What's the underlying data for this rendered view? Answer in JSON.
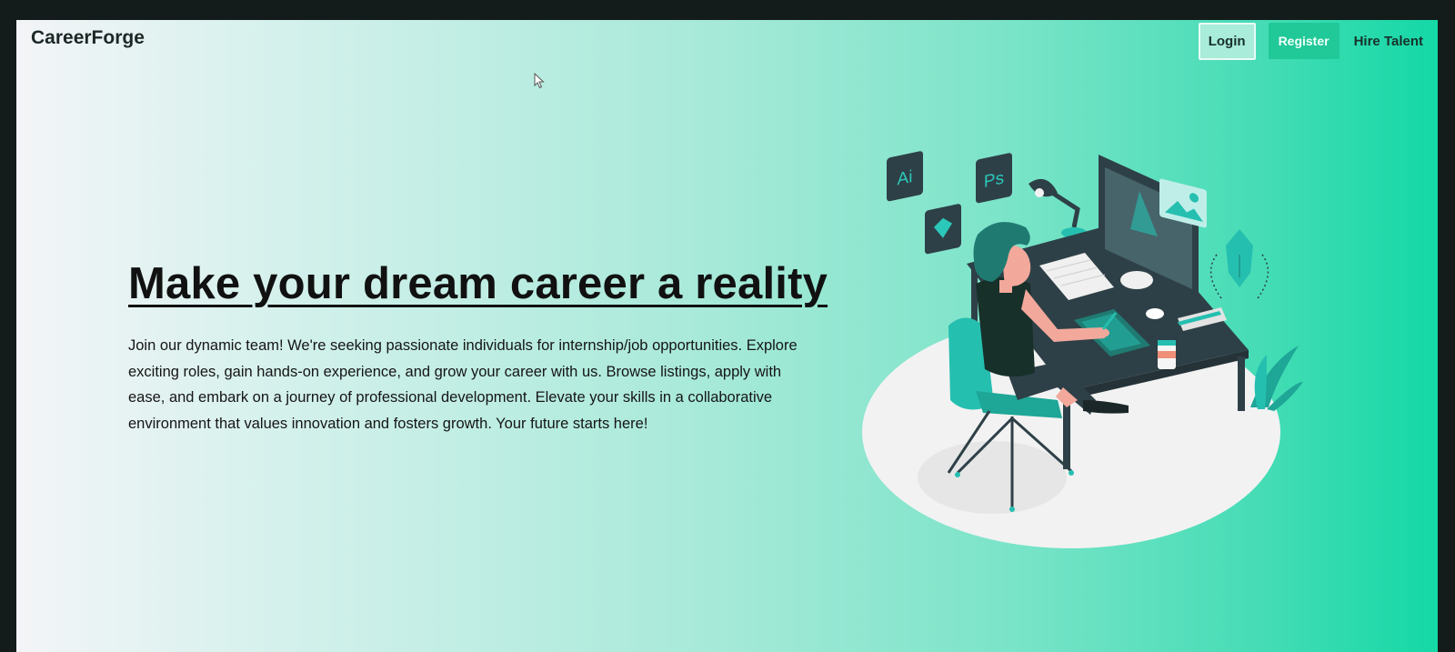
{
  "brand": {
    "name": "CareerForge"
  },
  "nav": {
    "login": "Login",
    "register": "Register",
    "hire": "Hire Talent"
  },
  "hero": {
    "headline": "Make your dream career a reality",
    "description": "Join our dynamic team! We're seeking passionate individuals for internship/job opportunities. Explore exciting roles, gain hands-on experience, and grow your career with us. Browse listings, apply with ease, and embark on a journey of professional development. Elevate your skills in a collaborative environment that values innovation and fosters growth. Your future starts here!"
  },
  "illustration": {
    "name": "designer-at-desk-illustration",
    "badges": [
      "Ai",
      "Ps"
    ]
  },
  "colors": {
    "accent": "#20c997",
    "dark": "#2e4047",
    "teal": "#25bfb0"
  }
}
